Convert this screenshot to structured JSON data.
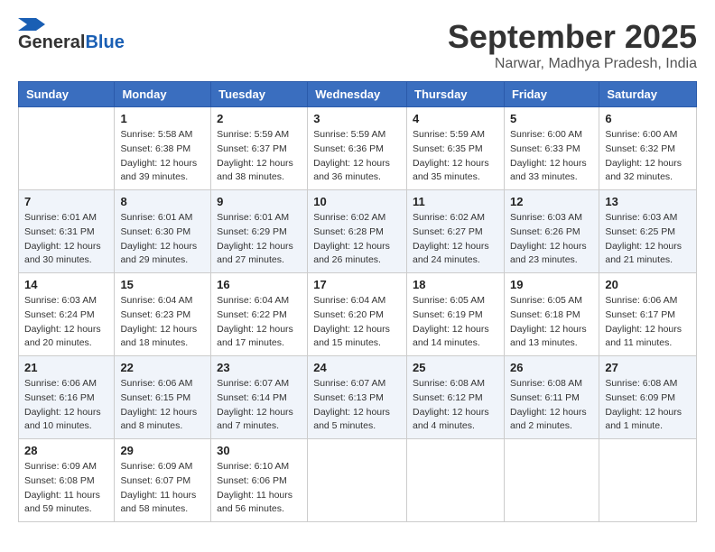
{
  "logo": {
    "line1": "General",
    "line2": "Blue"
  },
  "title": "September 2025",
  "location": "Narwar, Madhya Pradesh, India",
  "weekdays": [
    "Sunday",
    "Monday",
    "Tuesday",
    "Wednesday",
    "Thursday",
    "Friday",
    "Saturday"
  ],
  "weeks": [
    [
      {
        "day": "",
        "info": ""
      },
      {
        "day": "1",
        "info": "Sunrise: 5:58 AM\nSunset: 6:38 PM\nDaylight: 12 hours\nand 39 minutes."
      },
      {
        "day": "2",
        "info": "Sunrise: 5:59 AM\nSunset: 6:37 PM\nDaylight: 12 hours\nand 38 minutes."
      },
      {
        "day": "3",
        "info": "Sunrise: 5:59 AM\nSunset: 6:36 PM\nDaylight: 12 hours\nand 36 minutes."
      },
      {
        "day": "4",
        "info": "Sunrise: 5:59 AM\nSunset: 6:35 PM\nDaylight: 12 hours\nand 35 minutes."
      },
      {
        "day": "5",
        "info": "Sunrise: 6:00 AM\nSunset: 6:33 PM\nDaylight: 12 hours\nand 33 minutes."
      },
      {
        "day": "6",
        "info": "Sunrise: 6:00 AM\nSunset: 6:32 PM\nDaylight: 12 hours\nand 32 minutes."
      }
    ],
    [
      {
        "day": "7",
        "info": "Sunrise: 6:01 AM\nSunset: 6:31 PM\nDaylight: 12 hours\nand 30 minutes."
      },
      {
        "day": "8",
        "info": "Sunrise: 6:01 AM\nSunset: 6:30 PM\nDaylight: 12 hours\nand 29 minutes."
      },
      {
        "day": "9",
        "info": "Sunrise: 6:01 AM\nSunset: 6:29 PM\nDaylight: 12 hours\nand 27 minutes."
      },
      {
        "day": "10",
        "info": "Sunrise: 6:02 AM\nSunset: 6:28 PM\nDaylight: 12 hours\nand 26 minutes."
      },
      {
        "day": "11",
        "info": "Sunrise: 6:02 AM\nSunset: 6:27 PM\nDaylight: 12 hours\nand 24 minutes."
      },
      {
        "day": "12",
        "info": "Sunrise: 6:03 AM\nSunset: 6:26 PM\nDaylight: 12 hours\nand 23 minutes."
      },
      {
        "day": "13",
        "info": "Sunrise: 6:03 AM\nSunset: 6:25 PM\nDaylight: 12 hours\nand 21 minutes."
      }
    ],
    [
      {
        "day": "14",
        "info": "Sunrise: 6:03 AM\nSunset: 6:24 PM\nDaylight: 12 hours\nand 20 minutes."
      },
      {
        "day": "15",
        "info": "Sunrise: 6:04 AM\nSunset: 6:23 PM\nDaylight: 12 hours\nand 18 minutes."
      },
      {
        "day": "16",
        "info": "Sunrise: 6:04 AM\nSunset: 6:22 PM\nDaylight: 12 hours\nand 17 minutes."
      },
      {
        "day": "17",
        "info": "Sunrise: 6:04 AM\nSunset: 6:20 PM\nDaylight: 12 hours\nand 15 minutes."
      },
      {
        "day": "18",
        "info": "Sunrise: 6:05 AM\nSunset: 6:19 PM\nDaylight: 12 hours\nand 14 minutes."
      },
      {
        "day": "19",
        "info": "Sunrise: 6:05 AM\nSunset: 6:18 PM\nDaylight: 12 hours\nand 13 minutes."
      },
      {
        "day": "20",
        "info": "Sunrise: 6:06 AM\nSunset: 6:17 PM\nDaylight: 12 hours\nand 11 minutes."
      }
    ],
    [
      {
        "day": "21",
        "info": "Sunrise: 6:06 AM\nSunset: 6:16 PM\nDaylight: 12 hours\nand 10 minutes."
      },
      {
        "day": "22",
        "info": "Sunrise: 6:06 AM\nSunset: 6:15 PM\nDaylight: 12 hours\nand 8 minutes."
      },
      {
        "day": "23",
        "info": "Sunrise: 6:07 AM\nSunset: 6:14 PM\nDaylight: 12 hours\nand 7 minutes."
      },
      {
        "day": "24",
        "info": "Sunrise: 6:07 AM\nSunset: 6:13 PM\nDaylight: 12 hours\nand 5 minutes."
      },
      {
        "day": "25",
        "info": "Sunrise: 6:08 AM\nSunset: 6:12 PM\nDaylight: 12 hours\nand 4 minutes."
      },
      {
        "day": "26",
        "info": "Sunrise: 6:08 AM\nSunset: 6:11 PM\nDaylight: 12 hours\nand 2 minutes."
      },
      {
        "day": "27",
        "info": "Sunrise: 6:08 AM\nSunset: 6:09 PM\nDaylight: 12 hours\nand 1 minute."
      }
    ],
    [
      {
        "day": "28",
        "info": "Sunrise: 6:09 AM\nSunset: 6:08 PM\nDaylight: 11 hours\nand 59 minutes."
      },
      {
        "day": "29",
        "info": "Sunrise: 6:09 AM\nSunset: 6:07 PM\nDaylight: 11 hours\nand 58 minutes."
      },
      {
        "day": "30",
        "info": "Sunrise: 6:10 AM\nSunset: 6:06 PM\nDaylight: 11 hours\nand 56 minutes."
      },
      {
        "day": "",
        "info": ""
      },
      {
        "day": "",
        "info": ""
      },
      {
        "day": "",
        "info": ""
      },
      {
        "day": "",
        "info": ""
      }
    ]
  ]
}
